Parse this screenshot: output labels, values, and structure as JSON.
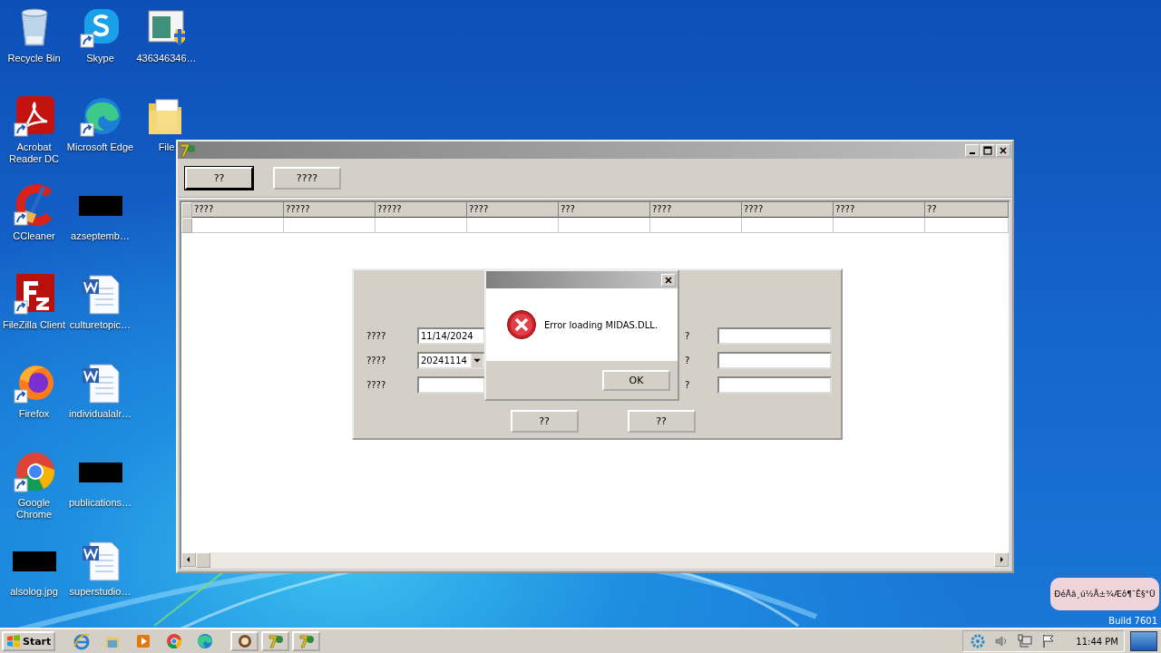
{
  "desktop": {
    "columns": [
      [
        {
          "label": "Recycle Bin",
          "kind": "recycle",
          "shortcut": false
        },
        {
          "label": "Acrobat Reader DC",
          "kind": "acrobat",
          "shortcut": true
        },
        {
          "label": "CCleaner",
          "kind": "ccleaner",
          "shortcut": true
        },
        {
          "label": "FileZilla Client",
          "kind": "filezilla",
          "shortcut": true
        },
        {
          "label": "Firefox",
          "kind": "firefox",
          "shortcut": true
        },
        {
          "label": "Google Chrome",
          "kind": "chrome",
          "shortcut": true
        },
        {
          "label": "alsolog.jpg",
          "kind": "black",
          "shortcut": false
        }
      ],
      [
        {
          "label": "Skype",
          "kind": "skype",
          "shortcut": true
        },
        {
          "label": "Microsoft Edge",
          "kind": "edge",
          "shortcut": true
        },
        {
          "label": "azseptemb…",
          "kind": "black",
          "shortcut": false
        },
        {
          "label": "culturetopic…",
          "kind": "word",
          "shortcut": false
        },
        {
          "label": "individualalr…",
          "kind": "word",
          "shortcut": false
        },
        {
          "label": "publications…",
          "kind": "black",
          "shortcut": false
        },
        {
          "label": "superstudio…",
          "kind": "word",
          "shortcut": false
        }
      ],
      [
        {
          "label": "436346346…",
          "kind": "installer",
          "shortcut": false
        },
        {
          "label": "File",
          "kind": "folder",
          "shortcut": false
        }
      ]
    ]
  },
  "window": {
    "toolbar": [
      {
        "label": "??",
        "default": true
      },
      {
        "label": "????",
        "default": false
      }
    ],
    "table": {
      "columns": [
        "????",
        "?????",
        "?????",
        "????",
        "???",
        "????",
        "????",
        "????",
        "??"
      ]
    },
    "form": {
      "left": [
        {
          "label": "????",
          "dropdown": false,
          "value": "11/14/2024"
        },
        {
          "label": "????",
          "dropdown": true,
          "value": "20241114"
        },
        {
          "label": "????",
          "dropdown": false
        }
      ],
      "right": [
        {
          "label": "?"
        },
        {
          "label": "?"
        },
        {
          "label": "?"
        }
      ],
      "buttons": [
        "??",
        "??"
      ]
    }
  },
  "error_dialog": {
    "message": "Error loading MIDAS.DLL.",
    "button": "OK"
  },
  "balloon": {
    "text": "ÐéÄâ¸ú½Å±¾Æô¶¯Ê§°Ü"
  },
  "build": "Build 7601",
  "taskbar": {
    "start": "Start",
    "quick_launch": [
      {
        "kind": "ie"
      },
      {
        "kind": "explorer"
      },
      {
        "kind": "media"
      },
      {
        "kind": "chrome"
      },
      {
        "kind": "edge"
      }
    ],
    "tasks": [
      {
        "kind": "circle"
      },
      {
        "kind": "delphi"
      },
      {
        "kind": "delphi"
      }
    ],
    "clock": "11:44 PM"
  }
}
